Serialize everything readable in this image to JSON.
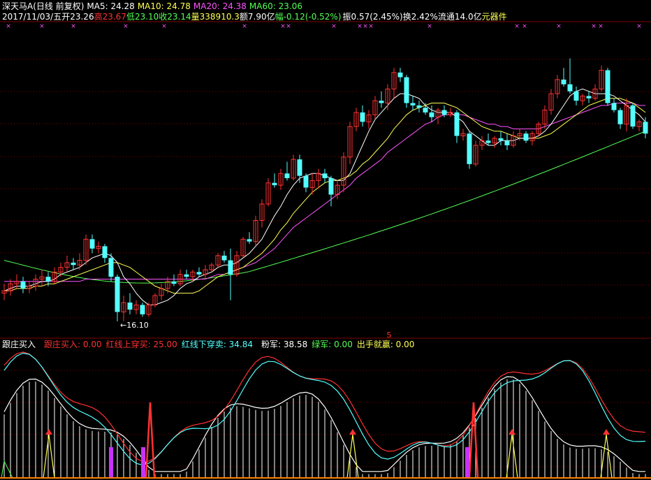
{
  "colors": {
    "red": "#ff3232",
    "cyan": "#54ffff",
    "yellow": "#ffff54",
    "green": "#54ff54",
    "magenta": "#ff54ff",
    "white": "#ffffff",
    "grid": "#800000",
    "purple": "#c832ff"
  },
  "header": {
    "stock": "深天马A",
    "period": "(日线 前复权)",
    "ma5": "MA5: 24.28",
    "ma10": "MA10: 24.78",
    "ma20": "MA20: 24.38",
    "ma60": "MA60: 23.06",
    "date": "2017/11/03/五",
    "open": "开23.26",
    "high": "高23.67",
    "low": "低23.10",
    "close": "收23.14",
    "volume": "量338910.3",
    "amount": "额7.90亿",
    "change": "幅-0.12(-0.52%)",
    "amplitude": "振0.57(2.45%)",
    "turnover": "换2.42%",
    "float": "流通14.0亿",
    "sector": "元器件"
  },
  "indicator": {
    "name": "跟庄买入",
    "buy": "跟庄买入: 0.00",
    "red_up": "红线上穿买: 25.00",
    "red_down": "红线下穿卖: 34.84",
    "pink": "粉军: 38.58",
    "green": "绿军: 0.00",
    "win": "出手就赢: 0.00"
  },
  "low_marker": "←16.10",
  "s_marker": "S",
  "chart_data": {
    "type": "candlestick",
    "price_range": [
      15.8,
      28.6
    ],
    "candles": [
      [
        17.3,
        17.0,
        17.7,
        17.4
      ],
      [
        17.4,
        17.2,
        17.9,
        17.7
      ],
      [
        17.7,
        17.5,
        18.1,
        17.8
      ],
      [
        17.8,
        17.3,
        18.0,
        17.5
      ],
      [
        17.5,
        17.3,
        17.8,
        17.6
      ],
      [
        17.6,
        17.4,
        18.1,
        17.9
      ],
      [
        17.9,
        17.6,
        18.3,
        18.0
      ],
      [
        18.0,
        17.6,
        18.2,
        17.8
      ],
      [
        17.8,
        17.7,
        18.4,
        18.2
      ],
      [
        18.2,
        18.0,
        18.6,
        18.4
      ],
      [
        18.4,
        18.2,
        18.9,
        18.6
      ],
      [
        18.6,
        18.3,
        18.8,
        18.5
      ],
      [
        18.5,
        18.3,
        19.0,
        18.7
      ],
      [
        18.7,
        18.5,
        19.8,
        19.6
      ],
      [
        19.6,
        19.0,
        19.8,
        19.2
      ],
      [
        19.2,
        19.0,
        19.5,
        19.3
      ],
      [
        19.3,
        18.6,
        19.4,
        18.8
      ],
      [
        18.8,
        17.8,
        19.0,
        18.0
      ],
      [
        18.0,
        16.1,
        18.1,
        16.5
      ],
      [
        16.5,
        16.1,
        17.2,
        16.9
      ],
      [
        16.9,
        16.4,
        17.3,
        16.6
      ],
      [
        16.6,
        16.4,
        17.0,
        16.8
      ],
      [
        16.8,
        16.3,
        16.9,
        16.4
      ],
      [
        16.4,
        16.3,
        16.9,
        16.8
      ],
      [
        16.8,
        16.7,
        17.3,
        17.2
      ],
      [
        17.2,
        17.0,
        17.7,
        17.5
      ],
      [
        17.5,
        17.3,
        18.0,
        17.8
      ],
      [
        17.8,
        17.6,
        18.1,
        17.7
      ],
      [
        17.7,
        17.6,
        18.3,
        18.1
      ],
      [
        18.1,
        17.9,
        18.3,
        18.0
      ],
      [
        18.0,
        17.8,
        18.3,
        18.2
      ],
      [
        18.2,
        18.0,
        18.4,
        18.1
      ],
      [
        18.1,
        17.9,
        18.5,
        18.3
      ],
      [
        18.3,
        18.2,
        18.6,
        18.5
      ],
      [
        18.5,
        18.4,
        19.0,
        18.9
      ],
      [
        18.9,
        18.6,
        19.1,
        18.7
      ],
      [
        18.7,
        17.0,
        19.2,
        18.1
      ],
      [
        18.1,
        18.0,
        19.1,
        18.9
      ],
      [
        18.9,
        18.8,
        19.7,
        19.6
      ],
      [
        19.6,
        19.4,
        19.9,
        19.5
      ],
      [
        19.5,
        19.3,
        20.6,
        20.4
      ],
      [
        20.4,
        20.1,
        21.3,
        21.1
      ],
      [
        21.1,
        21.0,
        22.2,
        22.0
      ],
      [
        22.0,
        21.8,
        22.4,
        21.9
      ],
      [
        21.9,
        21.7,
        22.6,
        22.4
      ],
      [
        22.4,
        22.1,
        22.9,
        22.2
      ],
      [
        22.2,
        22.1,
        23.2,
        23.0
      ],
      [
        23.0,
        22.0,
        23.2,
        22.3
      ],
      [
        22.3,
        21.6,
        22.4,
        21.8
      ],
      [
        21.8,
        21.5,
        22.4,
        22.1
      ],
      [
        22.1,
        21.8,
        22.6,
        22.4
      ],
      [
        22.4,
        22.0,
        22.6,
        22.2
      ],
      [
        22.2,
        21.0,
        22.3,
        21.5
      ],
      [
        21.5,
        21.3,
        22.1,
        21.9
      ],
      [
        21.9,
        21.6,
        23.3,
        23.1
      ],
      [
        23.1,
        22.8,
        24.6,
        24.4
      ],
      [
        24.4,
        24.2,
        25.2,
        25.0
      ],
      [
        25.0,
        24.4,
        25.3,
        24.6
      ],
      [
        24.6,
        24.3,
        25.1,
        24.9
      ],
      [
        24.9,
        24.7,
        25.7,
        25.5
      ],
      [
        25.5,
        25.2,
        25.9,
        25.4
      ],
      [
        25.4,
        25.1,
        26.2,
        26.0
      ],
      [
        26.0,
        25.6,
        26.9,
        26.7
      ],
      [
        26.7,
        26.3,
        26.9,
        26.5
      ],
      [
        26.5,
        25.2,
        26.6,
        25.4
      ],
      [
        25.4,
        25.1,
        25.7,
        25.3
      ],
      [
        25.3,
        25.0,
        25.5,
        25.2
      ],
      [
        25.2,
        24.9,
        25.4,
        25.0
      ],
      [
        25.0,
        24.6,
        25.3,
        24.8
      ],
      [
        24.8,
        24.5,
        25.2,
        25.1
      ],
      [
        25.1,
        24.8,
        25.3,
        24.9
      ],
      [
        24.9,
        24.8,
        25.2,
        25.0
      ],
      [
        25.0,
        23.7,
        25.1,
        24.0
      ],
      [
        24.0,
        23.8,
        24.3,
        24.1
      ],
      [
        24.1,
        22.6,
        24.2,
        22.8
      ],
      [
        22.8,
        22.7,
        23.8,
        23.6
      ],
      [
        23.6,
        23.4,
        24.0,
        23.8
      ],
      [
        23.8,
        23.6,
        24.1,
        23.7
      ],
      [
        23.7,
        23.5,
        24.0,
        23.9
      ],
      [
        23.9,
        23.6,
        24.2,
        23.8
      ],
      [
        23.8,
        23.4,
        24.1,
        23.6
      ],
      [
        23.6,
        23.5,
        24.2,
        24.0
      ],
      [
        24.0,
        23.8,
        24.3,
        24.1
      ],
      [
        24.1,
        23.7,
        24.2,
        23.8
      ],
      [
        23.8,
        23.6,
        24.2,
        24.1
      ],
      [
        24.1,
        24.0,
        24.6,
        24.5
      ],
      [
        24.5,
        24.3,
        25.3,
        25.1
      ],
      [
        25.1,
        24.9,
        26.0,
        25.8
      ],
      [
        25.8,
        25.6,
        26.6,
        26.4
      ],
      [
        26.4,
        26.1,
        26.9,
        26.2
      ],
      [
        26.2,
        25.8,
        27.3,
        25.9
      ],
      [
        25.9,
        25.3,
        26.1,
        25.5
      ],
      [
        25.5,
        25.3,
        25.8,
        25.7
      ],
      [
        25.7,
        25.4,
        25.9,
        25.6
      ],
      [
        25.6,
        25.5,
        26.2,
        26.0
      ],
      [
        26.0,
        25.9,
        27.0,
        26.8
      ],
      [
        26.8,
        25.3,
        26.9,
        25.4
      ],
      [
        25.4,
        25.0,
        25.6,
        25.1
      ],
      [
        25.1,
        24.3,
        25.2,
        24.5
      ],
      [
        24.5,
        24.2,
        25.6,
        25.3
      ],
      [
        25.3,
        24.3,
        25.4,
        24.4
      ],
      [
        24.4,
        24.2,
        24.7,
        24.6
      ],
      [
        24.6,
        23.9,
        24.8,
        24.1
      ]
    ],
    "ma5": [
      17.4,
      17.5,
      17.6,
      17.6,
      17.6,
      17.7,
      17.8,
      17.8,
      17.9,
      18.1,
      18.2,
      18.3,
      18.4,
      18.6,
      18.8,
      18.9,
      19.0,
      18.9,
      18.6,
      18.0,
      17.7,
      17.3,
      17.0,
      16.8,
      16.8,
      16.9,
      17.0,
      17.2,
      17.5,
      17.7,
      17.8,
      18.0,
      18.1,
      18.2,
      18.4,
      18.5,
      18.5,
      18.6,
      18.8,
      19.0,
      19.3,
      19.6,
      20.1,
      20.6,
      21.0,
      21.5,
      21.9,
      22.2,
      22.3,
      22.4,
      22.4,
      22.3,
      22.2,
      22.1,
      22.1,
      22.4,
      23.0,
      23.6,
      24.2,
      24.7,
      25.0,
      25.3,
      25.6,
      25.8,
      25.8,
      25.7,
      25.6,
      25.3,
      25.1,
      25.0,
      25.0,
      25.0,
      24.8,
      24.6,
      24.2,
      24.0,
      23.8,
      23.6,
      23.6,
      23.8,
      23.8,
      23.8,
      23.9,
      23.9,
      23.9,
      24.0,
      24.2,
      24.5,
      24.9,
      25.3,
      25.7,
      25.9,
      26.0,
      25.9,
      25.8,
      25.8,
      25.8,
      25.7,
      25.5,
      25.3,
      25.1,
      24.9,
      24.6
    ],
    "ma10": [
      17.4,
      17.4,
      17.5,
      17.5,
      17.5,
      17.6,
      17.6,
      17.7,
      17.7,
      17.8,
      17.9,
      18.0,
      18.1,
      18.2,
      18.3,
      18.4,
      18.5,
      18.6,
      18.6,
      18.5,
      18.4,
      18.2,
      18.0,
      17.8,
      17.6,
      17.5,
      17.4,
      17.3,
      17.3,
      17.3,
      17.3,
      17.4,
      17.6,
      17.8,
      18.0,
      18.1,
      18.2,
      18.3,
      18.4,
      18.6,
      18.8,
      19.0,
      19.3,
      19.6,
      20.0,
      20.3,
      20.7,
      21.0,
      21.3,
      21.6,
      21.8,
      22.0,
      22.1,
      22.1,
      22.2,
      22.3,
      22.5,
      22.8,
      23.0,
      23.3,
      23.6,
      23.9,
      24.3,
      24.6,
      24.9,
      25.1,
      25.2,
      25.3,
      25.4,
      25.4,
      25.4,
      25.3,
      25.2,
      25.0,
      24.8,
      24.6,
      24.4,
      24.3,
      24.2,
      24.2,
      24.1,
      24.0,
      23.9,
      23.9,
      23.9,
      23.9,
      24.0,
      24.1,
      24.3,
      24.5,
      24.7,
      24.9,
      25.1,
      25.3,
      25.4,
      25.5,
      25.6,
      25.6,
      25.6,
      25.5,
      25.4,
      25.2,
      25.0
    ],
    "ma20": [
      17.8,
      17.8,
      17.8,
      17.8,
      17.8,
      17.8,
      17.8,
      17.8,
      17.8,
      17.8,
      17.8,
      17.8,
      17.8,
      17.9,
      17.9,
      17.9,
      17.9,
      17.9,
      17.9,
      17.9,
      17.9,
      17.9,
      17.9,
      17.9,
      17.9,
      17.9,
      17.9,
      17.9,
      17.9,
      17.9,
      17.9,
      17.9,
      17.9,
      18.0,
      18.1,
      18.1,
      18.2,
      18.3,
      18.4,
      18.5,
      18.6,
      18.8,
      19.0,
      19.2,
      19.5,
      19.8,
      20.1,
      20.3,
      20.5,
      20.7,
      20.9,
      21.1,
      21.3,
      21.5,
      21.7,
      21.9,
      22.2,
      22.4,
      22.6,
      22.8,
      23.0,
      23.3,
      23.5,
      23.7,
      23.9,
      24.1,
      24.3,
      24.5,
      24.6,
      24.8,
      24.9,
      24.9,
      24.9,
      24.9,
      24.8,
      24.7,
      24.6,
      24.5,
      24.5,
      24.4,
      24.4,
      24.3,
      24.3,
      24.3,
      24.3,
      24.3,
      24.4,
      24.5,
      24.6,
      24.7,
      24.8,
      24.9,
      25.0,
      25.1,
      25.2,
      25.3,
      25.3,
      25.4,
      25.4,
      25.4,
      25.4,
      25.3,
      25.3
    ],
    "ma60_range": [
      18.7,
      17.4,
      18.2,
      24.2
    ]
  }
}
